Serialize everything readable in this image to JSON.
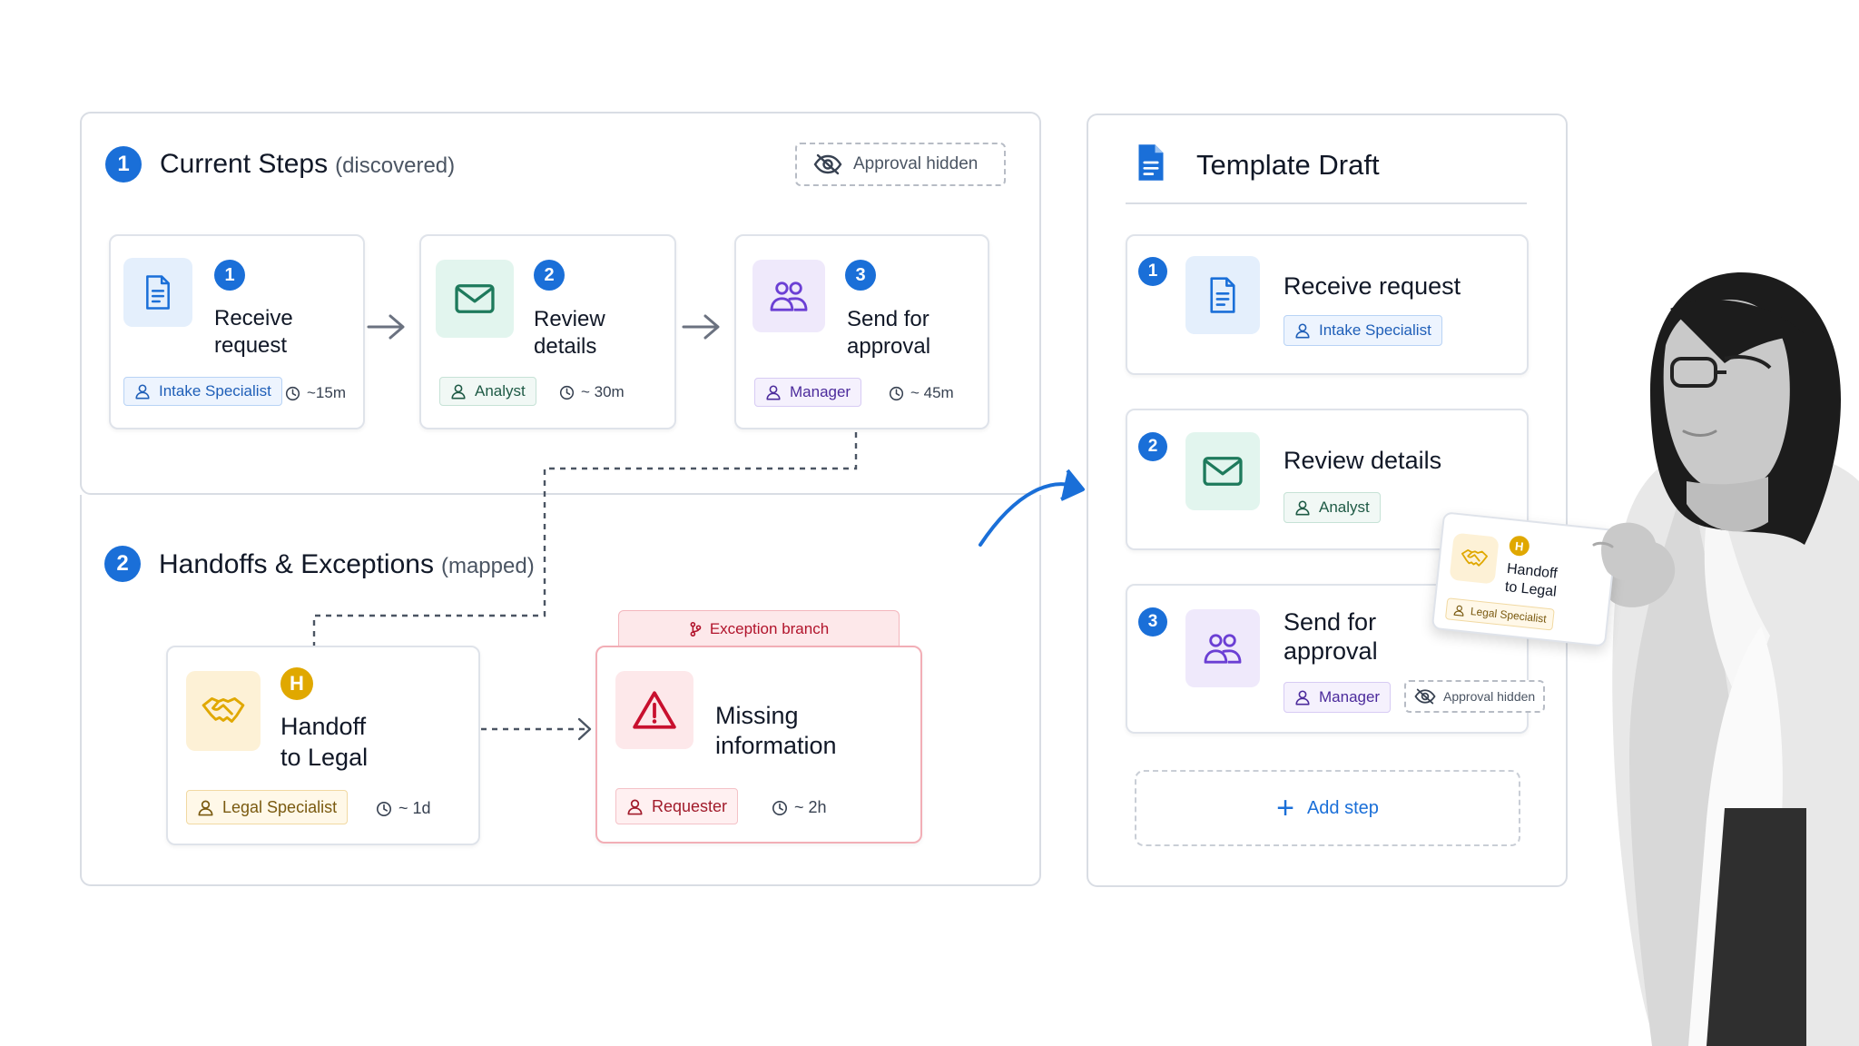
{
  "current": {
    "num": "1",
    "title": "Current Steps",
    "subtitle": "(discovered)",
    "hidden_badge": "Approval hidden",
    "steps": [
      {
        "num": "1",
        "title_l1": "Receive",
        "title_l2": "request",
        "role": "Intake Specialist",
        "time": "~15m"
      },
      {
        "num": "2",
        "title_l1": "Review",
        "title_l2": "details",
        "role": "Analyst",
        "time": "~ 30m"
      },
      {
        "num": "3",
        "title_l1": "Send for",
        "title_l2": "approval",
        "role": "Manager",
        "time": "~ 45m"
      }
    ]
  },
  "handoffs": {
    "num": "2",
    "title": "Handoffs & Exceptions",
    "subtitle": "(mapped)",
    "handoff": {
      "badge": "H",
      "title_l1": "Handoff",
      "title_l2": "to Legal",
      "role": "Legal Specialist",
      "time": "~ 1d"
    },
    "exception": {
      "branch_label": "Exception branch",
      "title_l1": "Missing",
      "title_l2": "information",
      "role": "Requester",
      "time": "~ 2h"
    }
  },
  "template": {
    "title": "Template Draft",
    "steps": [
      {
        "num": "1",
        "title": "Receive request",
        "role": "Intake Specialist"
      },
      {
        "num": "2",
        "title": "Review details",
        "role": "Analyst"
      },
      {
        "num": "3",
        "title_l1": "Send for",
        "title_l2": "approval",
        "role": "Manager",
        "hidden_badge": "Approval hidden"
      }
    ],
    "add_step": "Add step"
  },
  "held_card": {
    "badge": "H",
    "title_l1": "Handoff",
    "title_l2": "to Legal",
    "role": "Legal Specialist"
  },
  "colors": {
    "accent_blue": "#1a6fd8",
    "green": "#1e7a5c",
    "purple": "#6b3fd4",
    "amber": "#e0a800",
    "red": "#c8102e",
    "border": "#d9dde4"
  }
}
